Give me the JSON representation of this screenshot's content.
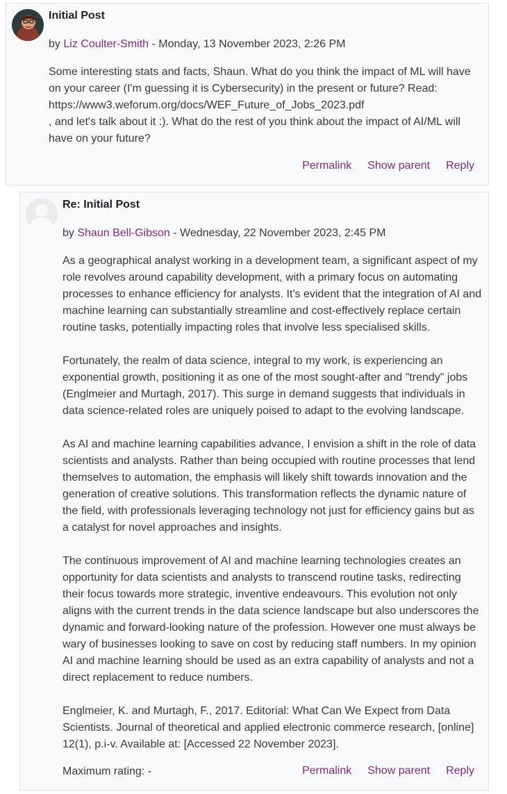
{
  "posts": [
    {
      "subject": "Initial Post",
      "by_prefix": "by",
      "author": "Liz Coulter-Smith",
      "date": " - Monday, 13 November 2023, 2:26 PM",
      "paragraphs": [
        "Some interesting stats and facts, Shaun. What do you think the impact of ML will have on your career (I'm guessing it is Cybersecurity) in the present or future? Read:",
        "https://www3.weforum.org/docs/WEF_Future_of_Jobs_2023.pdf",
        ", and let's talk about it :). What do the rest of you think about the impact of AI/ML will have on your future?"
      ],
      "commands": [
        "Permalink",
        "Show parent",
        "Reply"
      ]
    },
    {
      "subject": "Re: Initial Post",
      "by_prefix": "by",
      "author": "Shaun Bell-Gibson",
      "date": " - Wednesday, 22 November 2023, 2:45 PM",
      "paragraphs": [
        "As a geographical analyst working in a development team, a significant aspect of my role revolves around capability development, with a primary focus on automating processes to enhance efficiency for analysts. It's evident that the integration of AI and machine learning can substantially streamline and cost-effectively replace certain routine tasks, potentially impacting roles that involve less specialised skills.",
        "Fortunately, the realm of data science, integral to my work, is experiencing an exponential growth, positioning it as one of the most sought-after and \"trendy\" jobs (Englmeier and Murtagh, 2017). This surge in demand suggests that individuals in data science-related roles are uniquely poised to adapt to the evolving landscape.",
        "As AI and machine learning capabilities advance, I envision a shift in the role of data scientists and analysts. Rather than being occupied with routine processes that lend themselves to automation, the emphasis will likely shift towards innovation and the generation of creative solutions. This transformation reflects the dynamic nature of the field, with professionals leveraging technology not just for efficiency gains but as a catalyst for novel approaches and insights.",
        "The continuous improvement of AI and machine learning technologies creates an opportunity for data scientists and analysts to transcend routine tasks, redirecting their focus towards more strategic, inventive endeavours. This evolution not only aligns with the current trends in the data science landscape but also underscores the dynamic and forward-looking nature of the profession. However one must always be wary of businesses looking to save on cost by reducing staff numbers. In my opinion AI and machine learning should be used as an extra capability of analysts and not a direct replacement to reduce numbers.",
        "Englmeier, K. and Murtagh, F., 2017. Editorial: What Can We Expect from Data Scientists. Journal of theoretical and applied electronic commerce research, [online] 12(1), p.i-v. Available at: [Accessed 22 November 2023]."
      ],
      "rating": "Maximum rating: -",
      "commands": [
        "Permalink",
        "Show parent",
        "Reply"
      ]
    }
  ],
  "colors": {
    "link": "#7a2d7a",
    "post_bg": "#f8f9fa",
    "border": "#dee2e6"
  }
}
